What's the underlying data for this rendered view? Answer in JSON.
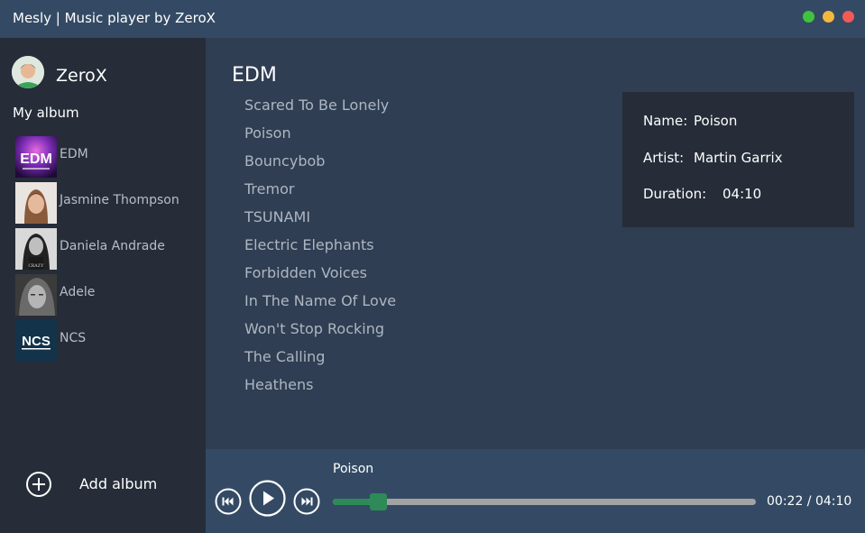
{
  "window": {
    "title": "Mesly | Music player by ZeroX",
    "controls": [
      {
        "name": "maximize",
        "color": "#3fc33f"
      },
      {
        "name": "minimize",
        "color": "#f4b83c"
      },
      {
        "name": "close",
        "color": "#f25a55"
      }
    ]
  },
  "sidebar": {
    "username": "ZeroX",
    "section_label": "My album",
    "albums": [
      {
        "label": "EDM"
      },
      {
        "label": "Jasmine Thompson"
      },
      {
        "label": "Daniela Andrade"
      },
      {
        "label": "Adele"
      },
      {
        "label": "NCS"
      }
    ],
    "thumb_text": {
      "edm": "EDM",
      "daniela": "CRAZY",
      "ncs": "NCS"
    },
    "add_album_label": "Add album"
  },
  "main": {
    "playlist_title": "EDM",
    "tracks": [
      "Scared To Be Lonely",
      "Poison",
      "Bouncybob",
      "Tremor",
      "TSUNAMI",
      "Electric Elephants",
      "Forbidden Voices",
      "In The Name Of Love",
      "Won't Stop Rocking",
      "The Calling",
      "Heathens"
    ]
  },
  "info": {
    "name_label": "Name:",
    "name_value": "Poison",
    "artist_label": "Artist:",
    "artist_value": "Martin Garrix",
    "duration_label": "Duration:",
    "duration_value": "04:10"
  },
  "player": {
    "now_playing": "Poison",
    "time_display": "00:22 / 04:10",
    "progress_fraction": 0.088,
    "accent_color": "#2e8b57"
  }
}
